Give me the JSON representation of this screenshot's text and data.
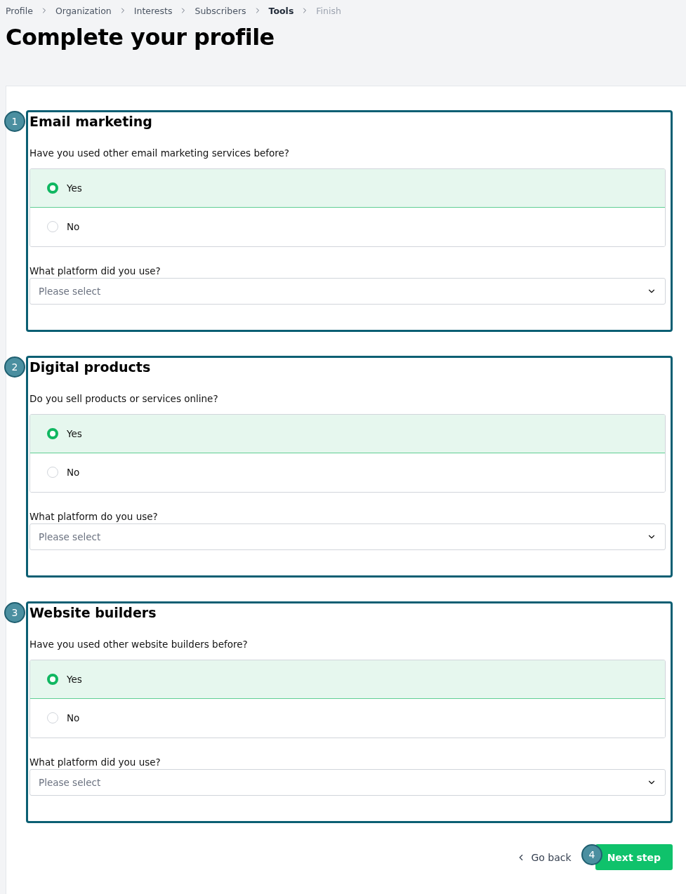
{
  "breadcrumb": [
    {
      "label": "Profile",
      "current": false,
      "disabled": false
    },
    {
      "label": "Organization",
      "current": false,
      "disabled": false
    },
    {
      "label": "Interests",
      "current": false,
      "disabled": false
    },
    {
      "label": "Subscribers",
      "current": false,
      "disabled": false
    },
    {
      "label": "Tools",
      "current": true,
      "disabled": false
    },
    {
      "label": "Finish",
      "current": false,
      "disabled": true
    }
  ],
  "title": "Complete your profile",
  "sections": [
    {
      "marker": "1",
      "heading": "Email marketing",
      "question": "Have you used other email marketing services before?",
      "options": [
        {
          "label": "Yes",
          "selected": true
        },
        {
          "label": "No",
          "selected": false
        }
      ],
      "select_label": "What platform did you use?",
      "select": {
        "placeholder": "Please select"
      }
    },
    {
      "marker": "2",
      "heading": "Digital products",
      "question": "Do you sell products or services online?",
      "options": [
        {
          "label": "Yes",
          "selected": true
        },
        {
          "label": "No",
          "selected": false
        }
      ],
      "select_label": "What platform do you use?",
      "select": {
        "placeholder": "Please select"
      }
    },
    {
      "marker": "3",
      "heading": "Website builders",
      "question": "Have you used other website builders before?",
      "options": [
        {
          "label": "Yes",
          "selected": true
        },
        {
          "label": "No",
          "selected": false
        }
      ],
      "select_label": "What platform did you use?",
      "select": {
        "placeholder": "Please select"
      }
    }
  ],
  "footer": {
    "back": "Go back",
    "marker": "4",
    "next": "Next step"
  }
}
